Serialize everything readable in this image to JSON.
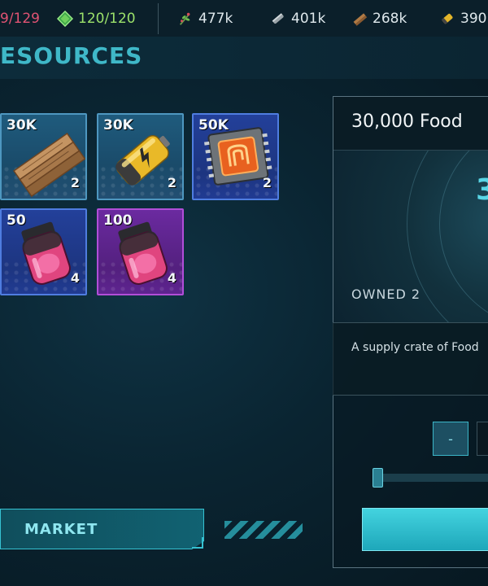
{
  "topbar": {
    "hp": "9/129",
    "energy": "120/120",
    "food": "477k",
    "metal": "401k",
    "wood": "268k",
    "battery": "390",
    "icons": {
      "energy": "green-gem-icon",
      "food": "herb-sprig-icon",
      "metal": "metal-ingot-icon",
      "wood": "wood-plank-icon",
      "battery": "battery-icon"
    }
  },
  "section": {
    "title": "ESOURCES"
  },
  "items": [
    {
      "tag": "30K",
      "count": "2",
      "icon": "wood-planks-icon",
      "rarity": "blue"
    },
    {
      "tag": "30K",
      "count": "2",
      "icon": "battery-icon",
      "rarity": "blue"
    },
    {
      "tag": "50K",
      "count": "2",
      "icon": "microchip-icon",
      "rarity": "navy"
    },
    {
      "tag": "50",
      "count": "4",
      "icon": "pink-serum-vial-icon",
      "rarity": "navy"
    },
    {
      "tag": "100",
      "count": "4",
      "icon": "pink-serum-vial-icon",
      "rarity": "purple"
    }
  ],
  "detail": {
    "title": "30,000 Food",
    "big_number": "3",
    "owned": "OWNED 2",
    "description": "A supply crate of Food",
    "minus_label": "-"
  },
  "market": {
    "label": "MARKET"
  },
  "colors": {
    "accent": "#3fb8c8",
    "hp": "#e05373",
    "energy": "#9ce26b"
  }
}
